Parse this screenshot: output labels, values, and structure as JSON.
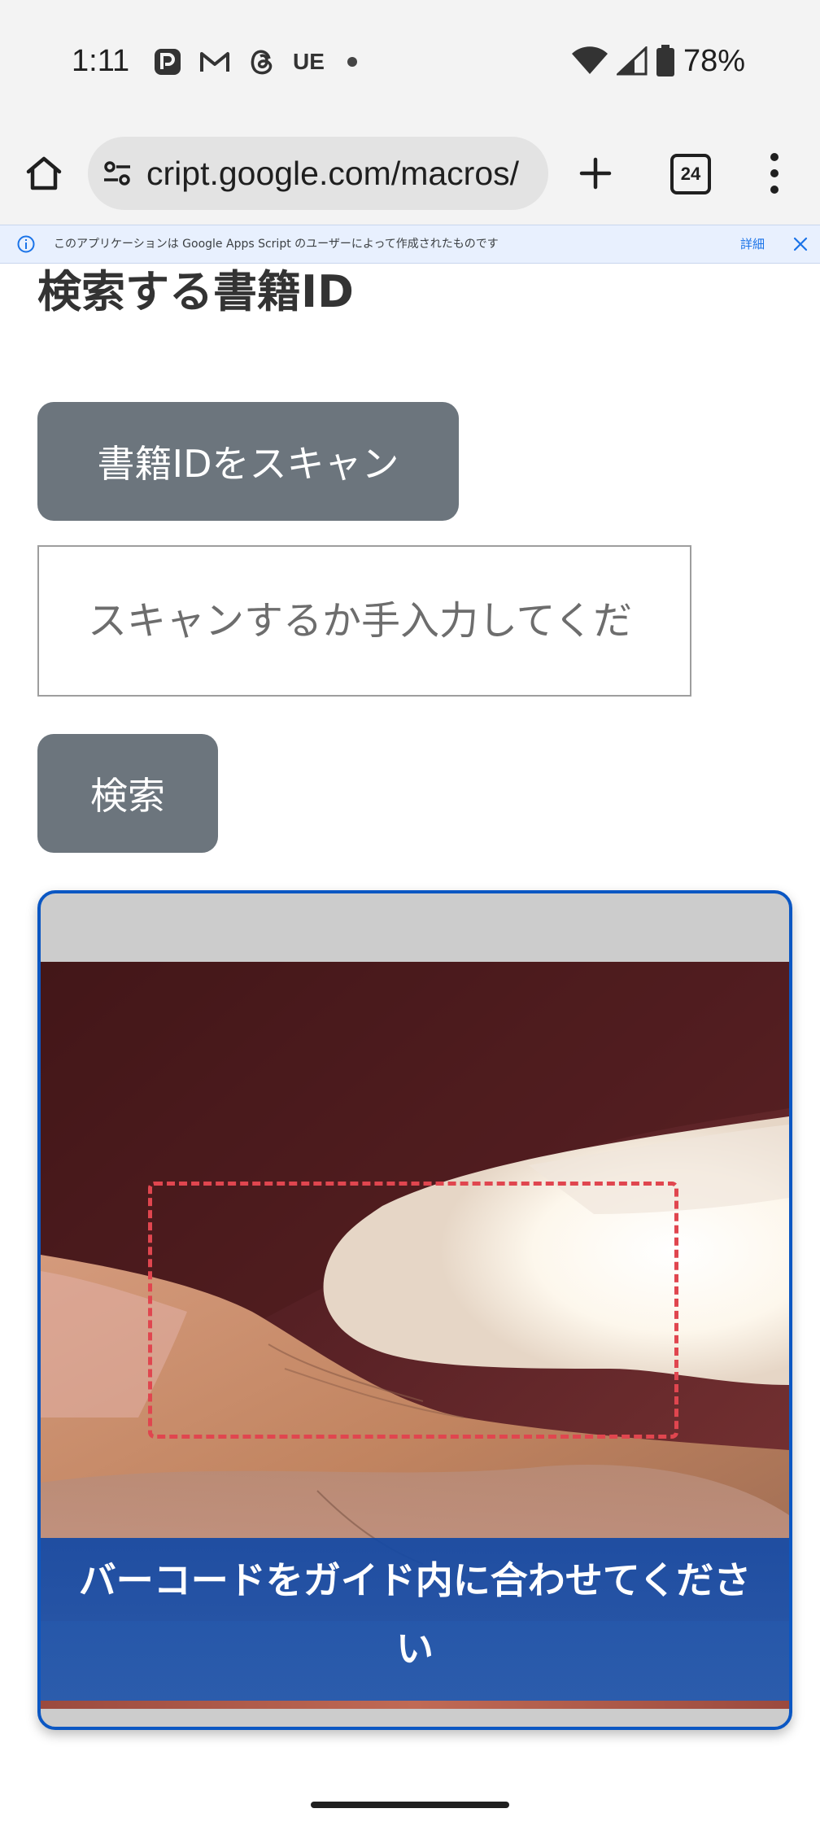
{
  "status_bar": {
    "time": "1:11",
    "left_icons": [
      "picsart-icon",
      "gmail-icon",
      "threads-icon"
    ],
    "ue_label": "UE",
    "battery_percent": "78%"
  },
  "browser": {
    "url": "cript.google.com/macros/",
    "tab_count": "24"
  },
  "info_banner": {
    "text": "このアプリケーションは Google Apps Script のユーザーによって作成されたものです",
    "detail_link": "詳細"
  },
  "page": {
    "heading": "検索する書籍ID",
    "scan_button": "書籍IDをスキャン",
    "id_input_placeholder": "スキャンするか手入力してくだ",
    "id_input_value": "",
    "search_button": "検索"
  },
  "scanner": {
    "guide_text": "バーコードをガイド内に合わせてください"
  },
  "colors": {
    "button_gray": "#6c757d",
    "scanner_border": "#0b57c3",
    "guide_dash": "#e0464f",
    "guide_text_bg": "#1f4ea5"
  }
}
